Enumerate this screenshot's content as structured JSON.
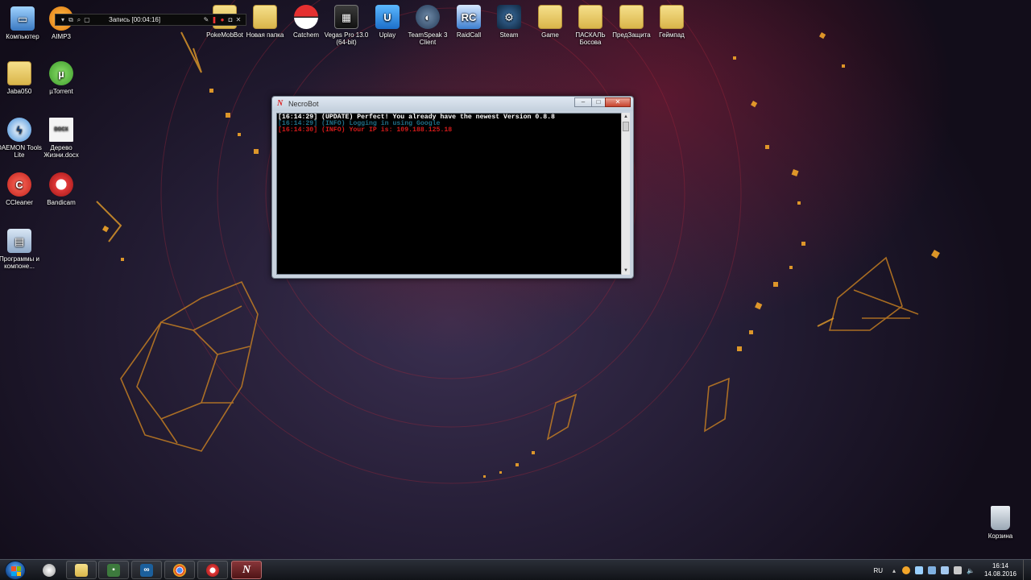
{
  "desktop": {
    "left_icons": [
      {
        "label": "Компьютер",
        "icon": "computer-icon"
      },
      {
        "label": "AIMP3",
        "icon": "aimp-icon"
      },
      {
        "label": "Jaba050",
        "icon": "folder-icon"
      },
      {
        "label": "µTorrent",
        "icon": "utorrent-icon"
      },
      {
        "label": "DAEMON Tools Lite",
        "icon": "daemon-tools-icon"
      },
      {
        "label": "Дерево Жизни.docx",
        "icon": "docx-icon"
      },
      {
        "label": "CCleaner",
        "icon": "ccleaner-icon"
      },
      {
        "label": "Bandicam",
        "icon": "bandicam-icon"
      },
      {
        "label": "Программы и компоне...",
        "icon": "programs-icon"
      }
    ],
    "top_icons": [
      {
        "label": "PokeMobBot",
        "icon": "folder-icon"
      },
      {
        "label": "Новая папка",
        "icon": "folder-icon"
      },
      {
        "label": "Catchem",
        "icon": "pokeball-icon"
      },
      {
        "label": "Vegas Pro 13.0 (64-bit)",
        "icon": "vegas-icon"
      },
      {
        "label": "Uplay",
        "icon": "uplay-icon"
      },
      {
        "label": "TeamSpeak 3 Client",
        "icon": "teamspeak-icon"
      },
      {
        "label": "RaidCall",
        "icon": "raidcall-icon"
      },
      {
        "label": "Steam",
        "icon": "steam-icon"
      },
      {
        "label": "Game",
        "icon": "folder-icon"
      },
      {
        "label": "ПАСКАЛЬ Босова",
        "icon": "folder-icon"
      },
      {
        "label": "ПредЗащита",
        "icon": "folder-icon"
      },
      {
        "label": "Геймпад",
        "icon": "folder-icon"
      }
    ],
    "recycle_bin": {
      "label": "Корзина",
      "icon": "recycle-bin-icon"
    }
  },
  "recording_bar": {
    "text": "Запись [00:04:16]"
  },
  "necrobot": {
    "title": "NecroBot",
    "buttons": {
      "minimize": "–",
      "maximize": "□",
      "close": "✕"
    },
    "lines": [
      {
        "text": "[16:14:29] (UPDATE) Perfect! You already have the newest Version 0.8.8",
        "color": "#ffffff"
      },
      {
        "text": "[16:14:29] (INFO) Logging in using Google",
        "color": "#1f6e86"
      },
      {
        "text": "[16:14:30] (INFO) Your IP is: 109.188.125.18",
        "color": "#d51a1a"
      }
    ]
  },
  "taskbar": {
    "items": [
      {
        "name": "explorer",
        "icon": "folder-icon",
        "color": "#e6c45a"
      },
      {
        "name": "cmd",
        "icon": "terminal-icon",
        "color": "#3d7a3d"
      },
      {
        "name": "vs",
        "icon": "visual-studio-icon",
        "color": "#1b5f9c"
      },
      {
        "name": "chrome",
        "icon": "chrome-icon",
        "color": "#d93a2b"
      },
      {
        "name": "bandicam",
        "icon": "bandicam-icon",
        "color": "#c62020"
      },
      {
        "name": "necrobot",
        "icon": "necrobot-icon",
        "color": "#d31e1e"
      }
    ],
    "tray": {
      "lang": "RU",
      "time": "16:14",
      "date": "14.08.2016"
    }
  }
}
